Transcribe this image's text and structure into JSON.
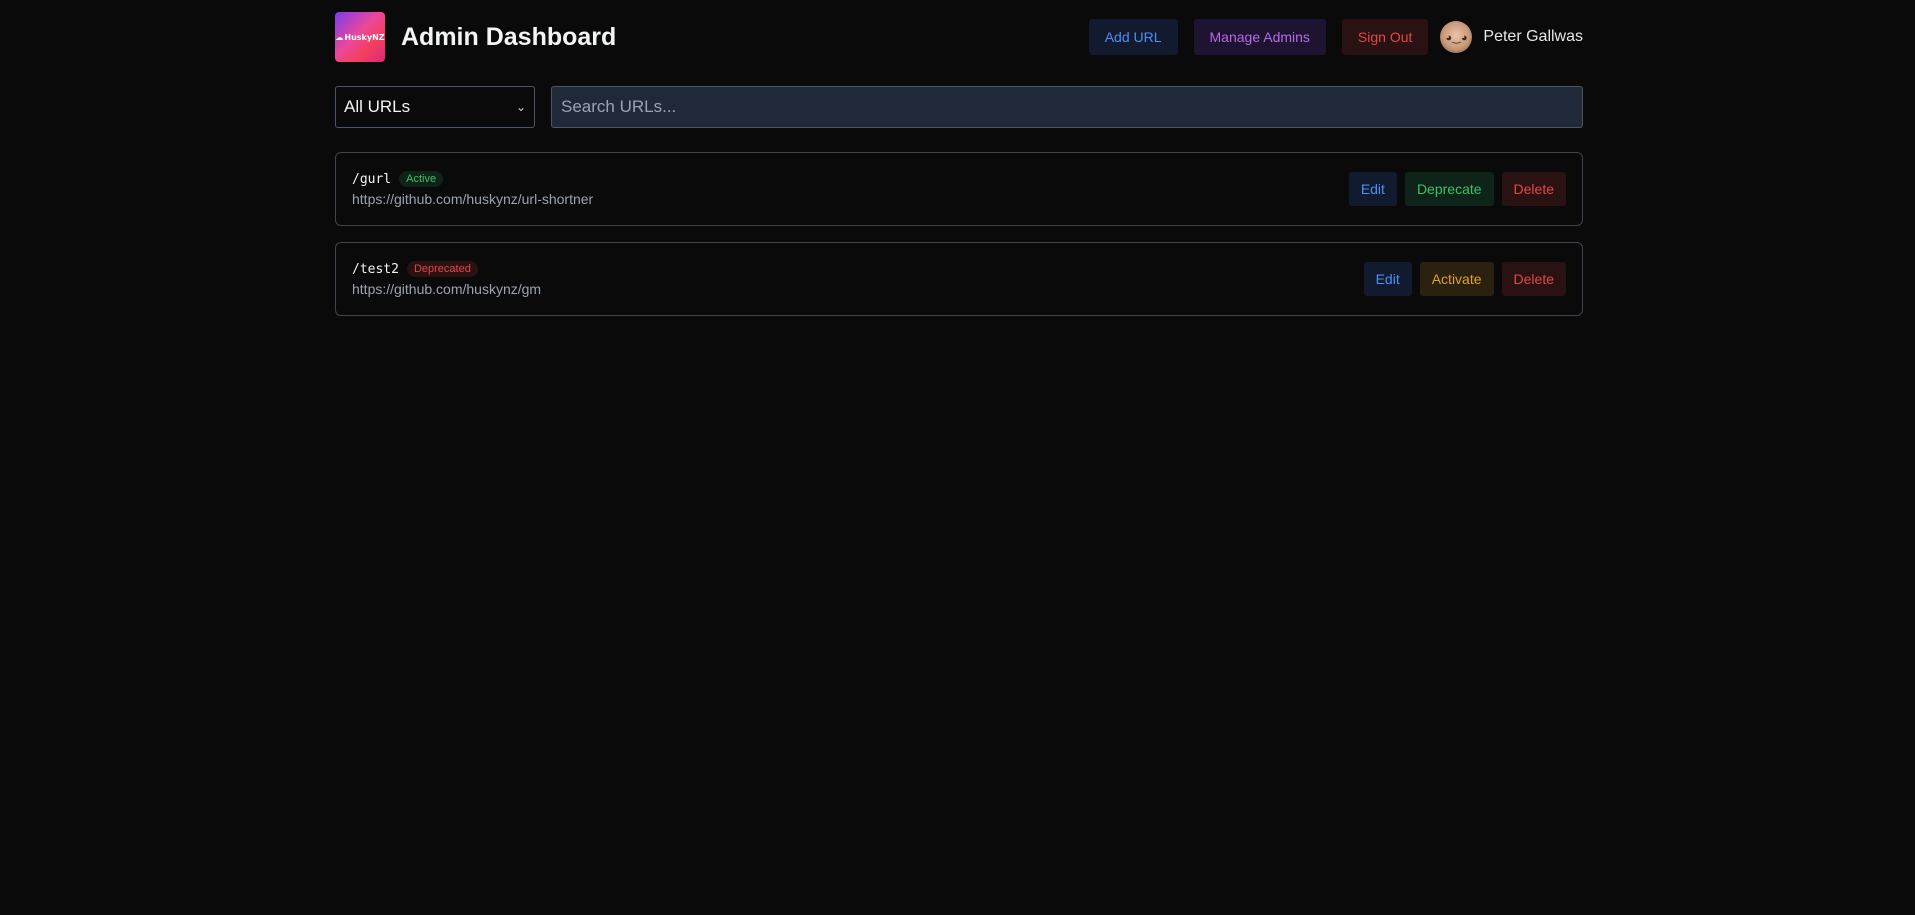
{
  "header": {
    "logo_text": "HuskyNZ",
    "title": "Admin Dashboard",
    "buttons": {
      "add_url": "Add URL",
      "manage_admins": "Manage Admins",
      "sign_out": "Sign Out"
    },
    "user": {
      "name": "Peter Gallwas"
    }
  },
  "filters": {
    "select_value": "All URLs",
    "search_placeholder": "Search URLs..."
  },
  "urls": [
    {
      "slug": "/gurl",
      "status": "Active",
      "target": "https://github.com/huskynz/url-shortner",
      "actions": {
        "edit": "Edit",
        "toggle": "Deprecate",
        "delete": "Delete"
      }
    },
    {
      "slug": "/test2",
      "status": "Deprecated",
      "target": "https://github.com/huskynz/gm",
      "actions": {
        "edit": "Edit",
        "toggle": "Activate",
        "delete": "Delete"
      }
    }
  ],
  "colors": {
    "background": "#0a0a0a",
    "blue": "#4f8ef7",
    "purple": "#b56be6",
    "red": "#e24848",
    "green": "#3fbf6a",
    "yellow": "#e0a128"
  }
}
